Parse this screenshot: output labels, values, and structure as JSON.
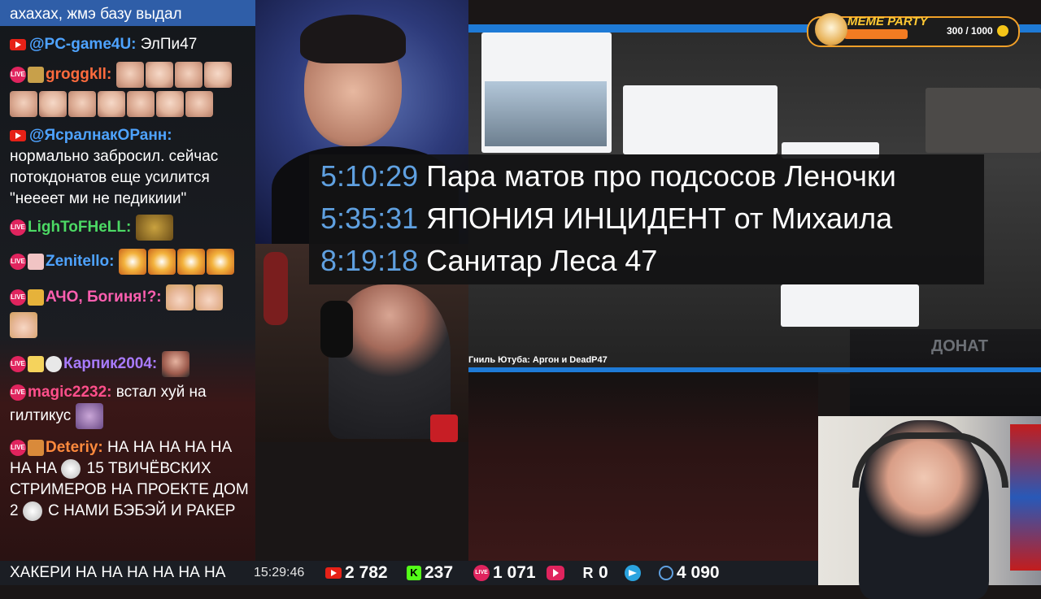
{
  "chat": {
    "top_message": "ахахах, жмэ базу выдал",
    "messages": [
      {
        "platform": "youtube",
        "nick": "@PC-game4U:",
        "nick_color": "#4ea3ff",
        "text": "ЭлПи47"
      },
      {
        "platform": "vk-live",
        "nick": "groggkll:",
        "nick_color": "#ff6b3d",
        "text": ""
      },
      {
        "platform": "youtube",
        "nick": "@ЯсралнакОРанн:",
        "nick_color": "#4ea3ff",
        "text": "нормально забросил. сейчас потокдонатов еще усилится \"неееет ми не педикиии\""
      },
      {
        "platform": "vk-live",
        "nick": "LighToFHeLL:",
        "nick_color": "#4cd964",
        "text": ""
      },
      {
        "platform": "vk-live",
        "nick": "Zenitello:",
        "nick_color": "#4ea3ff",
        "text": ""
      },
      {
        "platform": "vk-live",
        "nick": "АЧО, Богиня!?:",
        "nick_color": "#ff5fb0",
        "text": ""
      },
      {
        "platform": "vk-live",
        "nick": "Карпик2004:",
        "nick_color": "#a97bff",
        "text": ""
      },
      {
        "platform": "vk-live",
        "nick": "magic2232:",
        "nick_color": "#ff4f8b",
        "text": "встал хуй на гилтикус"
      },
      {
        "platform": "vk-live",
        "nick": "Deteriy:",
        "nick_color": "#ff8a3d",
        "text": "НА НА НА  НА НА НА НА",
        "text_2": "15 ТВИЧЁВСКИХ СТРИМЕРОВ НА ПРОЕКТЕ ДОМ 2",
        "text_3": "С НАМИ БЭБЭЙ И РАКЕР"
      }
    ]
  },
  "overlay": {
    "rows": [
      {
        "time": "5:10:29",
        "title": "Пара матов про подсосов Леночки"
      },
      {
        "time": "5:35:31",
        "title": "ЯПОНИЯ ИНЦИДЕНТ от Михаила"
      },
      {
        "time": "8:19:18",
        "title": "Санитар Леса 47"
      }
    ]
  },
  "screen": {
    "caption": "Гниль Ютуба: Аргон и DeadP47",
    "blurred_text": "ДОНАТ"
  },
  "meme_party": {
    "title": "MEME PARTY",
    "progress_text": "300 / 1000",
    "progress_fraction": 0.3
  },
  "statusbar": {
    "ticker": "ХАКЕРИ       НА НА НА НА НА НА",
    "clock": "15:29:46",
    "stats": [
      {
        "icon": "youtube-icon",
        "value": "2 782"
      },
      {
        "icon": "kick-icon",
        "value": "237"
      },
      {
        "icon": "vk-live-icon",
        "value": "1 071"
      },
      {
        "icon": "vk-video-icon",
        "value": ""
      },
      {
        "icon": "rutube-icon",
        "value": "0"
      },
      {
        "icon": "telegram-icon",
        "value": ""
      },
      {
        "icon": "viewers-icon",
        "value": "4 090"
      }
    ]
  },
  "colors": {
    "accent_blue": "#1e7ad6",
    "timestamp_blue": "#5fa0e0",
    "live_pink": "#e0245e",
    "meme_orange": "#f27b22"
  }
}
